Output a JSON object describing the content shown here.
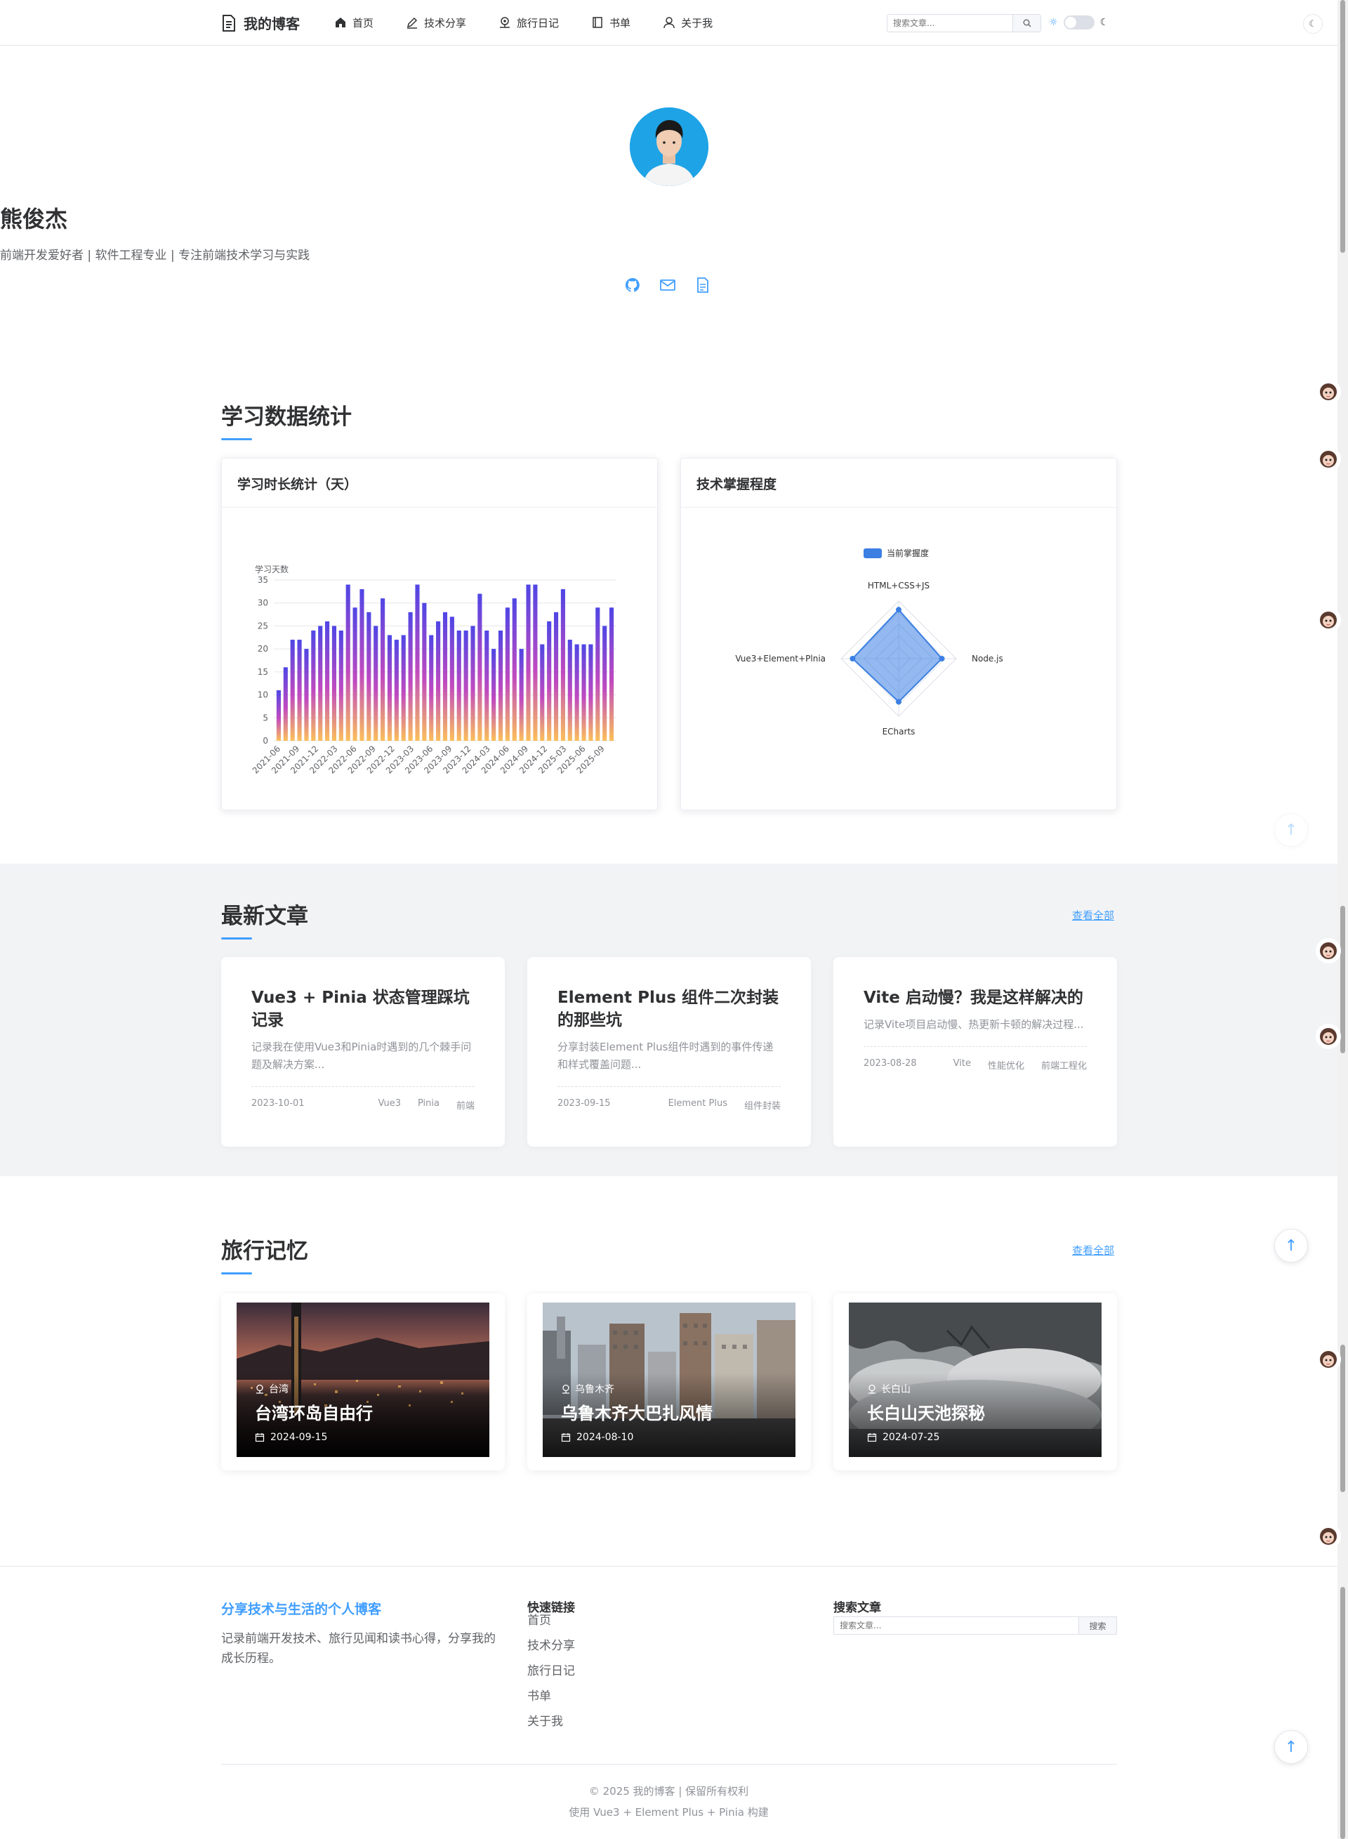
{
  "header": {
    "logo": "我的博客",
    "nav": [
      {
        "label": "首页",
        "icon": "home-icon"
      },
      {
        "label": "技术分享",
        "icon": "edit-icon"
      },
      {
        "label": "旅行日记",
        "icon": "location-icon"
      },
      {
        "label": "书单",
        "icon": "book-icon"
      },
      {
        "label": "关于我",
        "icon": "user-icon"
      }
    ],
    "search_placeholder": "搜索文章..."
  },
  "hero": {
    "name": "熊俊杰",
    "bio": "前端开发爱好者 | 软件工程专业 | 专注前端技术学习与实践",
    "social_icons": [
      "github-icon",
      "mail-icon",
      "document-icon"
    ]
  },
  "stats": {
    "title": "学习数据统计",
    "bar_card_title": "学习时长统计（天）",
    "radar_card_title": "技术掌握程度"
  },
  "chart_data": [
    {
      "type": "bar",
      "ylabel": "学习天数",
      "ylim": [
        0,
        35
      ],
      "yticks": [
        0,
        5,
        10,
        15,
        20,
        25,
        30,
        35
      ],
      "xticks": [
        "2021-06",
        "2021-09",
        "2021-12",
        "2022-03",
        "2022-06",
        "2022-09",
        "2022-12",
        "2023-03",
        "2023-06",
        "2023-09",
        "2023-12",
        "2024-03",
        "2024-06",
        "2024-09",
        "2024-12",
        "2025-03",
        "2025-06",
        "2025-09"
      ],
      "values": [
        11,
        16,
        22,
        22,
        20,
        24,
        25,
        26,
        25,
        24,
        34,
        29,
        33,
        28,
        25,
        31,
        23,
        22,
        23,
        28,
        34,
        30,
        23,
        26,
        28,
        27,
        24,
        24,
        25,
        32,
        24,
        20,
        24,
        29,
        31,
        20,
        34,
        34,
        21,
        26,
        28,
        33,
        22,
        21,
        21,
        21,
        29,
        25,
        29
      ],
      "gradient": [
        "#4f46e5",
        "#c04ac0",
        "#fbbf5a"
      ]
    },
    {
      "type": "radar",
      "legend": [
        "当前掌握度"
      ],
      "indicators": [
        "HTML+CSS+JS",
        "Node.js",
        "ECharts",
        "Vue3+Element+Plnia"
      ],
      "values": [
        85,
        75,
        75,
        80
      ],
      "max": 100,
      "color": "#3b7fe3"
    }
  ],
  "articles": {
    "title": "最新文章",
    "view_all": "查看全部",
    "items": [
      {
        "title": "Vue3 + Pinia 状态管理踩坑记录",
        "desc": "记录我在使用Vue3和Pinia时遇到的几个棘手问题及解决方案...",
        "date": "2023-10-01",
        "tags": [
          "Vue3",
          "Pinia",
          "前端"
        ]
      },
      {
        "title": "Element Plus 组件二次封装的那些坑",
        "desc": "分享封装Element Plus组件时遇到的事件传递和样式覆盖问题...",
        "date": "2023-09-15",
        "tags": [
          "Element Plus",
          "组件封装"
        ]
      },
      {
        "title": "Vite 启动慢？我是这样解决的",
        "desc": "记录Vite项目启动慢、热更新卡顿的解决过程...",
        "date": "2023-08-28",
        "tags": [
          "Vite",
          "性能优化",
          "前端工程化"
        ]
      }
    ]
  },
  "travel": {
    "title": "旅行记忆",
    "view_all": "查看全部",
    "items": [
      {
        "location": "台湾",
        "title": "台湾环岛自由行",
        "date": "2024-09-15"
      },
      {
        "location": "乌鲁木齐",
        "title": "乌鲁木齐大巴扎风情",
        "date": "2024-08-10"
      },
      {
        "location": "长白山",
        "title": "长白山天池探秘",
        "date": "2024-07-25"
      }
    ]
  },
  "footer": {
    "slogan": "分享技术与生活的个人博客",
    "desc": "记录前端开发技术、旅行见闻和读书心得，分享我的成长历程。",
    "links_title": "快速链接",
    "links": [
      "首页",
      "技术分享",
      "旅行日记",
      "书单",
      "关于我"
    ],
    "search_title": "搜索文章",
    "search_placeholder": "搜索文章...",
    "search_button": "搜索",
    "copyright": "© 2025 我的博客 | 保留所有权利",
    "built_with": "使用 Vue3 + Element Plus + Pinia 构建"
  }
}
